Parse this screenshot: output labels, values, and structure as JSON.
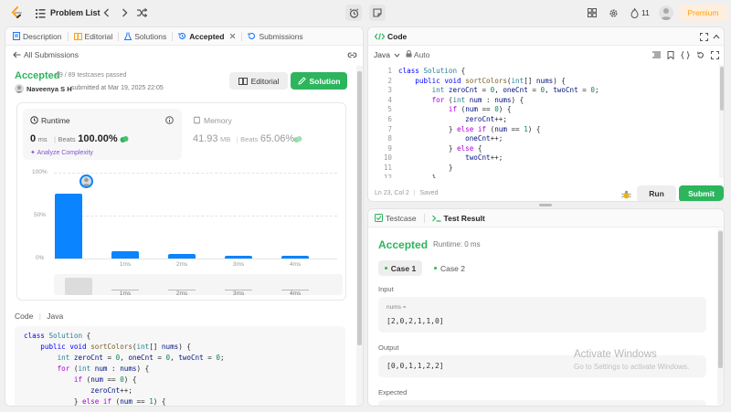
{
  "topbar": {
    "title": "Problem List",
    "streak": "11",
    "premium": "Premium",
    "logo_color": "#ffa116",
    "accent": "#ffa116"
  },
  "left_tabs": [
    {
      "label": "Description"
    },
    {
      "label": "Editorial"
    },
    {
      "label": "Solutions"
    },
    {
      "label": "Accepted"
    },
    {
      "label": "Submissions"
    }
  ],
  "sub": {
    "back": "All Submissions",
    "status": "Accepted",
    "passed": "89 / 89 testcases passed",
    "user": "Naveenya S H",
    "submitted": "submitted at Mar 19, 2025 22:05",
    "editorial_btn": "Editorial",
    "solution_btn": "Solution"
  },
  "runtime": {
    "label": "Runtime",
    "value": "0",
    "unit": "ms",
    "beats_label": "Beats",
    "beats": "100.00%",
    "analyze": "Analyze Complexity"
  },
  "memory": {
    "label": "Memory",
    "value": "41.93",
    "unit": "MB",
    "beats_label": "Beats",
    "beats": "65.06%"
  },
  "chart_data": {
    "type": "bar",
    "categories": [
      "",
      "1ms",
      "2ms",
      "3ms",
      "4ms"
    ],
    "values": [
      76,
      8,
      5,
      3,
      3
    ],
    "ylim": [
      0,
      100
    ],
    "yticks": [
      "100%",
      "50%",
      "0%"
    ],
    "mini_labels": [
      "1ms",
      "2ms",
      "3ms",
      "4ms"
    ]
  },
  "code_header": {
    "label": "Code",
    "lang": "Java"
  },
  "editor": {
    "title": "Code",
    "lang": "Java",
    "mode": "Auto",
    "status_pos": "Ln 23, Col 2",
    "status_saved": "Saved",
    "run": "Run",
    "submit": "Submit"
  },
  "line_numbers": [
    "1",
    "2",
    "3",
    "4",
    "5",
    "6",
    "7",
    "8",
    "9",
    "10",
    "11",
    "12"
  ],
  "result": {
    "tab_testcase": "Testcase",
    "tab_result": "Test Result",
    "status": "Accepted",
    "runtime": "Runtime: 0 ms",
    "case1": "Case 1",
    "case2": "Case 2",
    "input_label": "Input",
    "var_label": "nums =",
    "input_value": "[2,0,2,1,1,0]",
    "output_label": "Output",
    "output_value": "[0,0,1,1,2,2]",
    "expected_label": "Expected"
  },
  "watermark": {
    "line1": "Activate Windows",
    "line2": "Go to Settings to activate Windows."
  }
}
